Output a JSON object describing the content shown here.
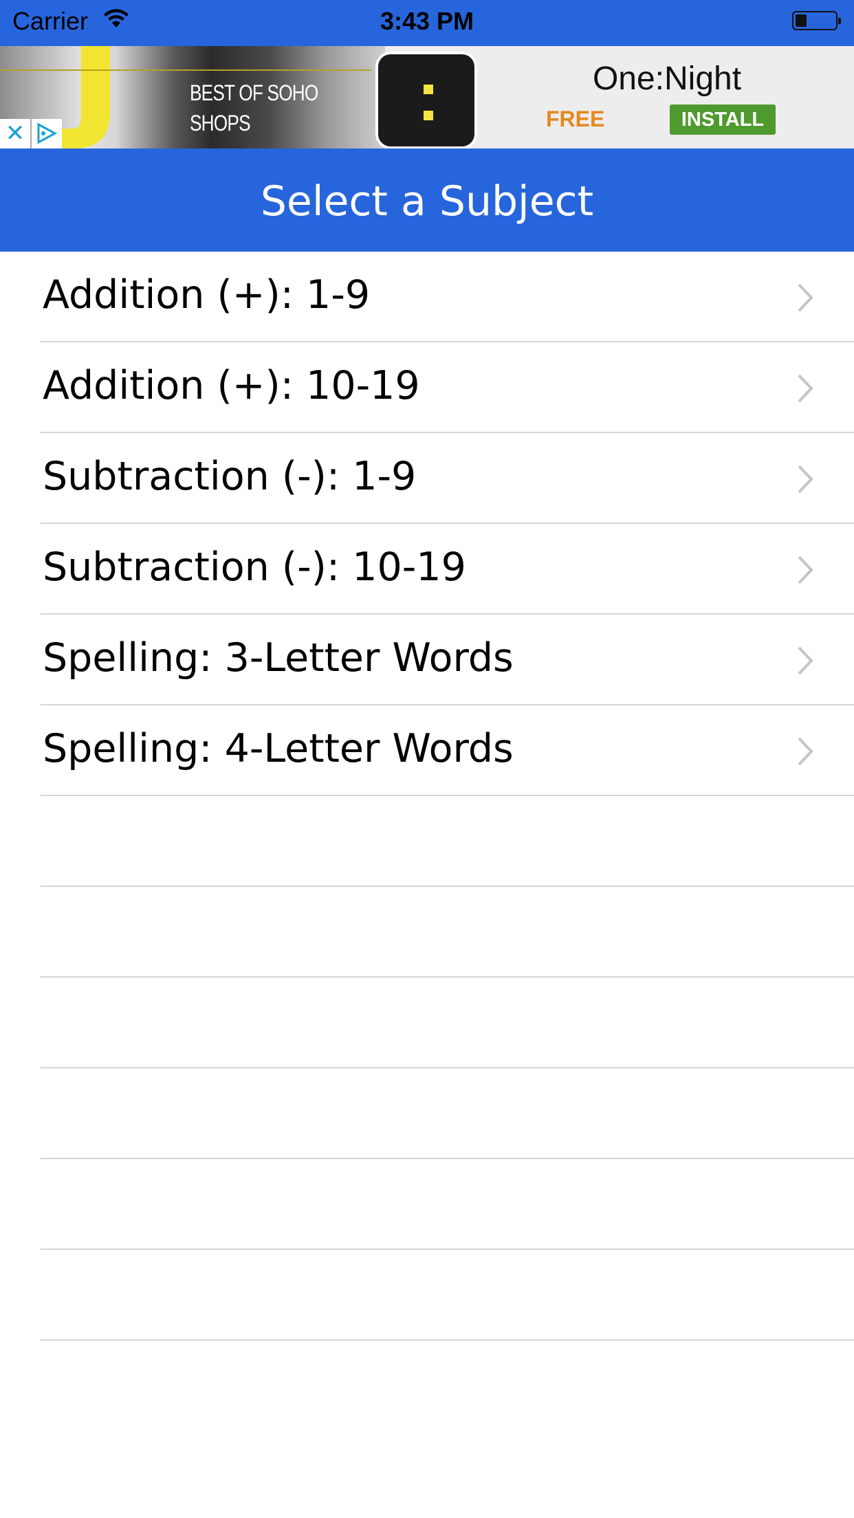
{
  "status_bar": {
    "carrier": "Carrier",
    "time": "3:43 PM",
    "wifi_icon": "wifi-icon",
    "battery_icon": "battery-low-icon"
  },
  "ad": {
    "photo_line1": "BEST OF SOHO",
    "photo_line2": "SHOPS",
    "close_glyph": "✕",
    "app_name": "One:Night",
    "price": "FREE",
    "install_label": "INSTALL",
    "colors": {
      "free": "#e4891c",
      "install_bg": "#4f9a2e"
    }
  },
  "nav": {
    "title": "Select a Subject",
    "color": "#2765dc"
  },
  "subjects": [
    {
      "label": "Addition (+): 1-9"
    },
    {
      "label": "Addition (+): 10-19"
    },
    {
      "label": "Subtraction (-): 1-9"
    },
    {
      "label": "Subtraction (-): 10-19"
    },
    {
      "label": "Spelling: 3-Letter Words"
    },
    {
      "label": "Spelling: 4-Letter Words"
    },
    {
      "label": ""
    },
    {
      "label": ""
    },
    {
      "label": ""
    },
    {
      "label": ""
    },
    {
      "label": ""
    },
    {
      "label": ""
    },
    {
      "label": ""
    }
  ]
}
